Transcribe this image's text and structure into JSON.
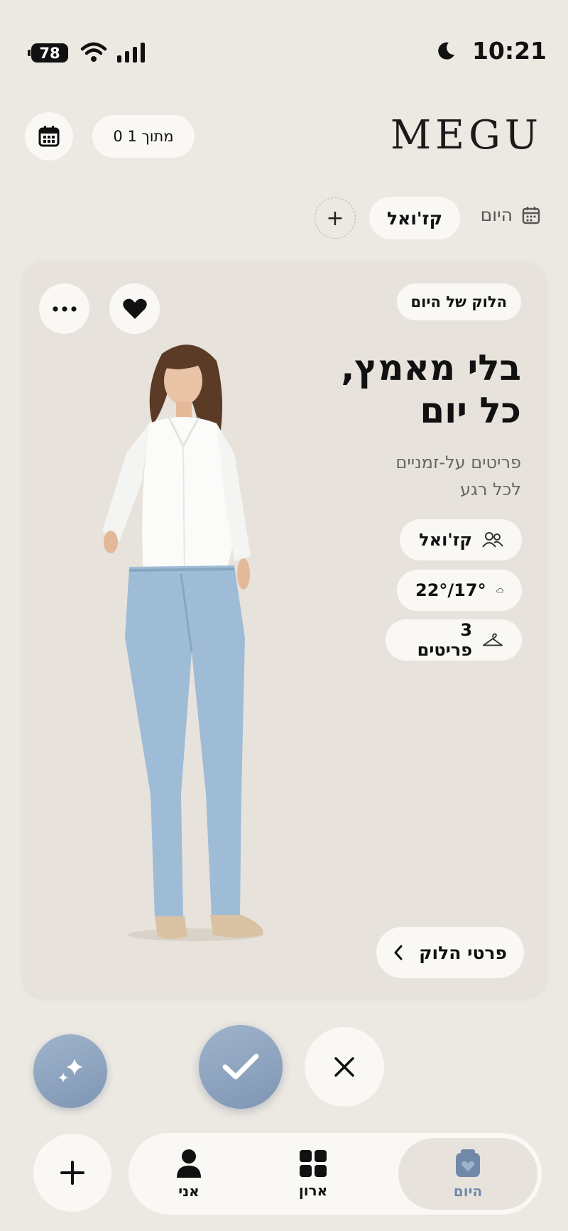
{
  "status_bar": {
    "battery": "78",
    "time": "10:21"
  },
  "header": {
    "brand": "MEGU",
    "count_label": "0 מתוך 1"
  },
  "filters": {
    "today_label": "היום",
    "style_chip": "קז'ואל",
    "add_symbol": "+"
  },
  "card": {
    "badge": "הלוק של היום",
    "headline_line1": "בלי מאמץ,",
    "headline_line2": "כל יום",
    "subhead_line1": "פריטים על-זמניים",
    "subhead_line2": "לכל רגע",
    "chips": [
      {
        "icon": "people-icon",
        "label": "קז'ואל"
      },
      {
        "icon": "cloud-icon",
        "label": "22°/17°"
      },
      {
        "icon": "hanger-icon",
        "label": "3 פריטים"
      }
    ],
    "details_button": "פרטי הלוק"
  },
  "nav": {
    "items": [
      {
        "label": "היום",
        "icon": "calendar-heart-icon",
        "active": true
      },
      {
        "label": "ארון",
        "icon": "grid-icon"
      },
      {
        "label": "אני",
        "icon": "person-icon"
      }
    ]
  },
  "colors": {
    "background": "#ece8e2",
    "accent": "#8aa0bd",
    "card": "#e7e3dc",
    "surface": "#faf8f5"
  }
}
